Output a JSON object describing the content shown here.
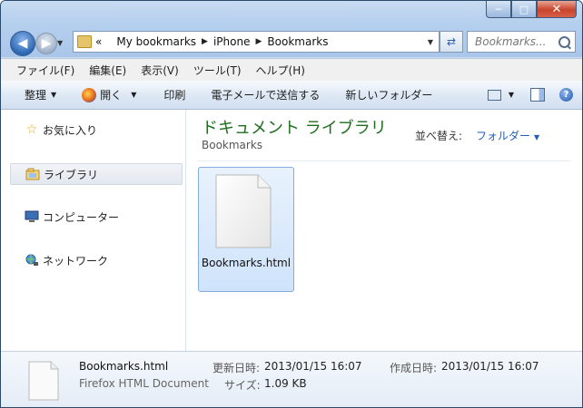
{
  "window": {
    "caption_buttons": {
      "minimize": "─",
      "maximize": "□",
      "close": "✕"
    }
  },
  "address_bar": {
    "overflow_marker": "«",
    "crumbs": [
      "My bookmarks",
      "iPhone",
      "Bookmarks"
    ]
  },
  "search": {
    "placeholder": "Bookmarks..."
  },
  "menu": {
    "items": [
      "ファイル(F)",
      "編集(E)",
      "表示(V)",
      "ツール(T)",
      "ヘルプ(H)"
    ]
  },
  "toolbar": {
    "organize": "整理",
    "open": "開く",
    "print": "印刷",
    "email": "電子メールで送信する",
    "new_folder": "新しいフォルダー"
  },
  "nav_pane": {
    "items": [
      {
        "label": "お気に入り",
        "icon": "star-icon"
      },
      {
        "label": "ライブラリ",
        "icon": "library-icon"
      },
      {
        "label": "コンピューター",
        "icon": "computer-icon"
      },
      {
        "label": "ネットワーク",
        "icon": "network-icon"
      }
    ]
  },
  "content": {
    "title": "ドキュメント ライブラリ",
    "subtitle": "Bookmarks",
    "sort_label": "並べ替え:",
    "sort_value": "フォルダー",
    "file": {
      "name": "Bookmarks.html",
      "icon": "document-icon"
    }
  },
  "details": {
    "name": "Bookmarks.html",
    "type": "Firefox HTML Document",
    "modified_label": "更新日時:",
    "modified_value": "2013/01/15 16:07",
    "created_label": "作成日時:",
    "created_value": "2013/01/15 16:07",
    "size_label": "サイズ:",
    "size_value": "1.09 KB"
  },
  "colors": {
    "library_title": "#1e6e1e",
    "accent_link": "#1f5fb8",
    "selection": "#cfe3fb"
  }
}
